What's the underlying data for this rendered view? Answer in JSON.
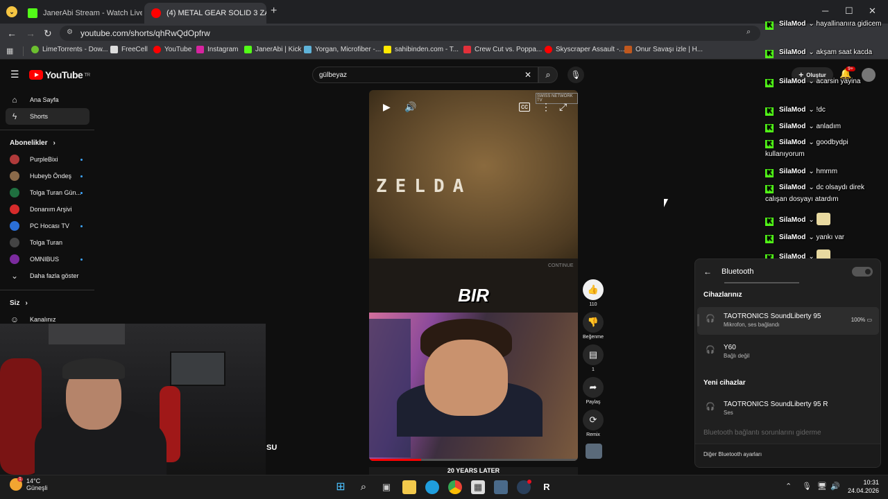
{
  "browser": {
    "tabs": [
      {
        "title": "JanerAbi Stream - Watch Live o",
        "favicon_color": "#53fc18"
      },
      {
        "title": "(4) METAL GEAR SOLID 3 ZAMA",
        "favicon_color": "#ff0000"
      }
    ],
    "url": "youtube.com/shorts/qhRwQdOpfrw",
    "bookmarks": [
      {
        "label": "LimeTorrents - Dow...",
        "color": "#6cbf2f"
      },
      {
        "label": "FreeCell",
        "color": "#dddddd"
      },
      {
        "label": "YouTube",
        "color": "#ff0000"
      },
      {
        "label": "Instagram",
        "color": "#d6249f"
      },
      {
        "label": "JanerAbi | Kick",
        "color": "#53fc18"
      },
      {
        "label": "Yorgan, Microfiber -...",
        "color": "#5fb3d9"
      },
      {
        "label": "sahibinden.com - T...",
        "color": "#ffe800"
      },
      {
        "label": "Crew Cut vs. Poppa...",
        "color": "#e2303a"
      },
      {
        "label": "Skyscraper Assault -...",
        "color": "#ff0000"
      },
      {
        "label": "Onur Savaşı izle | H...",
        "color": "#c0581e"
      }
    ]
  },
  "youtube": {
    "logo_text": "YouTube",
    "logo_region": "TR",
    "search_value": "gülbeyaz",
    "nav": {
      "home": "Ana Sayfa",
      "shorts": "Shorts"
    },
    "subscriptions_header": "Abonelikler",
    "subscriptions": [
      {
        "name": "PurpleBixi",
        "color": "#b03a3a"
      },
      {
        "name": "Hubeyb Öndeş",
        "color": "#8a6a4a"
      },
      {
        "name": "Tolga Turan Gün...",
        "color": "#1f6f3f"
      },
      {
        "name": "Donanım Arşivi",
        "color": "#d62b2b"
      },
      {
        "name": "PC Hocası TV",
        "color": "#2b6fd6"
      },
      {
        "name": "Tolga Turan",
        "color": "#444444"
      },
      {
        "name": "OMNIBUS",
        "color": "#7b2b9e"
      }
    ],
    "show_more": "Daha fazla göster",
    "you_header": "Siz",
    "your_channel": "Kanalınız",
    "create_label": "Oluştur",
    "notifications_count": "9+"
  },
  "video": {
    "top_text": "ZELDA",
    "caption": "BIR",
    "continue_label": "CONTINUE",
    "network_label": "SWISS NETWORK TV",
    "bottom_text": "20 YEARS LATER",
    "progress": 0.25
  },
  "actions": {
    "likes": "110",
    "dislike_label": "Beğenme",
    "comments": "1",
    "share_label": "Paylaş",
    "remix_label": "Remix"
  },
  "chat": [
    {
      "user": "SilaMod",
      "msg": "hayallinanıra gidicem"
    },
    {
      "user": "SilaMod",
      "msg": "akşam saat kacda"
    },
    {
      "user": "SilaMod",
      "msg": "acarsin yayina"
    },
    {
      "user": "SilaMod",
      "msg": "!dc"
    },
    {
      "user": "SilaMod",
      "msg": "anladım"
    },
    {
      "user": "SilaMod",
      "msg": "goodbydpi kullanıyorum"
    },
    {
      "user": "SilaMod",
      "msg": "hmmm"
    },
    {
      "user": "SilaMod",
      "msg": "dc olsaydı direk calışan dosyayı atardım"
    },
    {
      "user": "SilaMod",
      "msg": ""
    },
    {
      "user": "SilaMod",
      "msg": "yankı var"
    },
    {
      "user": "SilaMod",
      "msg": ""
    }
  ],
  "bluetooth": {
    "title": "Bluetooth",
    "enabled": true,
    "my_devices_header": "Cihazlarınız",
    "devices": [
      {
        "name": "TAOTRONICS SoundLiberty 95",
        "status": "Mikrofon, ses bağlandı",
        "battery": "100%"
      },
      {
        "name": "Y60",
        "status": "Bağlı değil"
      }
    ],
    "new_devices_header": "Yeni cihazlar",
    "new_devices": [
      {
        "name": "TAOTRONICS SoundLiberty 95 R",
        "status": "Ses"
      }
    ],
    "troubleshoot": "Bluetooth bağlantı sorunlarını giderme",
    "more_settings": "Diğer Bluetooth ayarları"
  },
  "overlay": {
    "webcam_text": "SU"
  },
  "taskbar": {
    "temperature": "14°C",
    "weather": "Güneşli",
    "weather_badge": "1",
    "time": "10:31",
    "date": "24.04.2026"
  }
}
